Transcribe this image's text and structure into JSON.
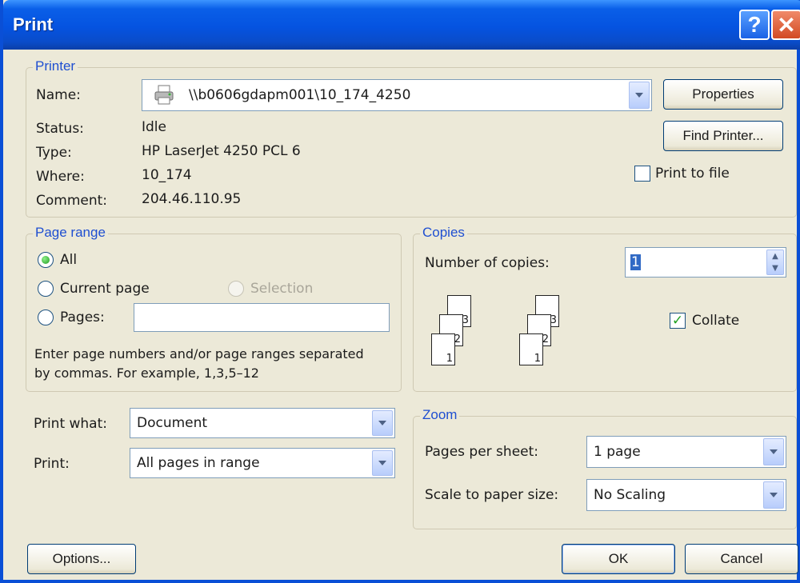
{
  "window": {
    "title": "Print",
    "help_label": "?",
    "close_label": "✕"
  },
  "printer": {
    "group_label": "Printer",
    "name_label": "Name:",
    "name_value": "\\\\b0606gdapm001\\10_174_4250",
    "status_label": "Status:",
    "status_value": "Idle",
    "type_label": "Type:",
    "type_value": "HP LaserJet 4250 PCL 6",
    "where_label": "Where:",
    "where_value": "10_174",
    "comment_label": "Comment:",
    "comment_value": "204.46.110.95",
    "properties_button": "Properties",
    "find_printer_button": "Find Printer...",
    "print_to_file_label": "Print to file",
    "print_to_file_checked": false,
    "printer_icon": "printer-icon"
  },
  "page_range": {
    "group_label": "Page range",
    "all_label": "All",
    "current_page_label": "Current page",
    "selection_label": "Selection",
    "pages_label": "Pages:",
    "pages_value": "",
    "selected": "all",
    "hint_line1": "Enter page numbers and/or page ranges separated",
    "hint_line2": "by commas.  For example, 1,3,5–12"
  },
  "copies": {
    "group_label": "Copies",
    "number_label": "Number of copies:",
    "number_value": "1",
    "collate_label": "Collate",
    "collate_checked": true,
    "page_numbers": [
      "1",
      "2",
      "3"
    ]
  },
  "print_what": {
    "label": "Print what:",
    "value": "Document"
  },
  "print": {
    "label": "Print:",
    "value": "All pages in range"
  },
  "zoom": {
    "group_label": "Zoom",
    "pages_per_sheet_label": "Pages per sheet:",
    "pages_per_sheet_value": "1 page",
    "scale_label": "Scale to paper size:",
    "scale_value": "No Scaling"
  },
  "footer": {
    "options_button": "Options...",
    "ok_button": "OK",
    "cancel_button": "Cancel"
  },
  "colors": {
    "titlebar": "#0553e0",
    "group_label": "#1f4fd1",
    "dialog_bg": "#ece9d8"
  }
}
